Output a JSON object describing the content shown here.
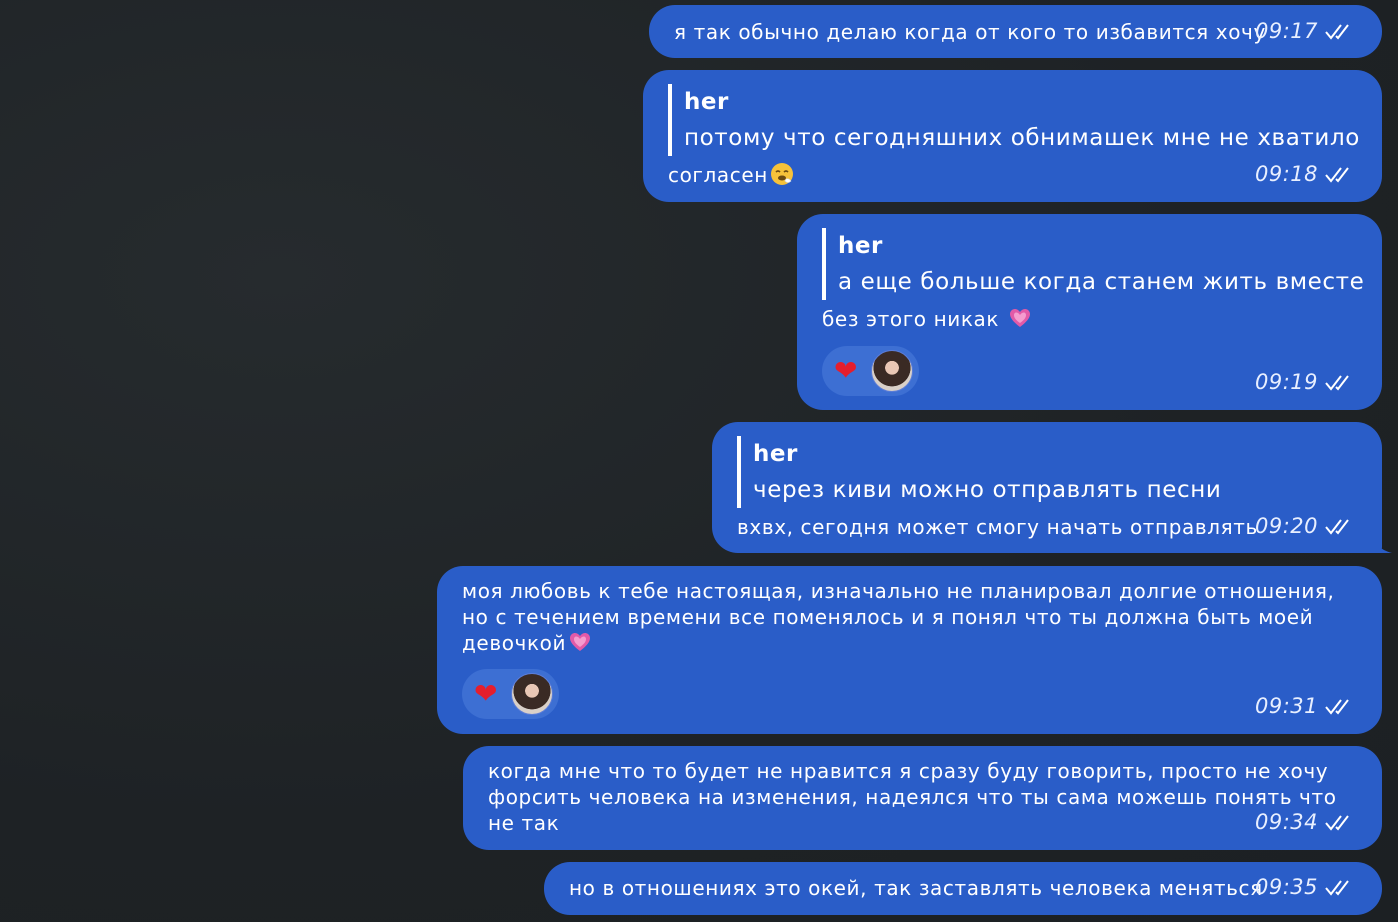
{
  "colors": {
    "background": "#1f2326",
    "bubble": "#2a5dc8",
    "reaction_pill": "#3d6fd3",
    "heart": "#e51e2d"
  },
  "messages": [
    {
      "text": "я так обычно делаю когда от кого то избавится хочу",
      "time": "09:17"
    },
    {
      "quote_author": "her",
      "quote_text": "потому что сегодняшних обнимашек мне не хватило",
      "text": "согласен",
      "emoji": "sneezing-face-emoji",
      "time": "09:18"
    },
    {
      "quote_author": "her",
      "quote_text": "а еще больше когда станем жить вместе",
      "text": "без этого никак",
      "emoji": "sparkling-heart-emoji",
      "reaction": "heart-icon",
      "time": "09:19"
    },
    {
      "quote_author": "her",
      "quote_text": "через киви можно отправлять песни",
      "text": "вхвх, сегодня может смогу начать отправлять",
      "time": "09:20"
    },
    {
      "text": "моя любовь к тебе настоящая, изначально не планировал долгие отношения, но с течением времени все поменялось и я понял что ты должна быть моей девочкой",
      "emoji": "sparkling-heart-emoji",
      "reaction": "heart-icon",
      "time": "09:31"
    },
    {
      "text": "когда мне что то будет не нравится я сразу буду говорить, просто не хочу форсить человека на изменения, надеялся что ты сама можешь понять что не так",
      "time": "09:34"
    },
    {
      "text": "но в отношениях это окей, так заставлять человека меняться",
      "time": "09:35"
    }
  ]
}
